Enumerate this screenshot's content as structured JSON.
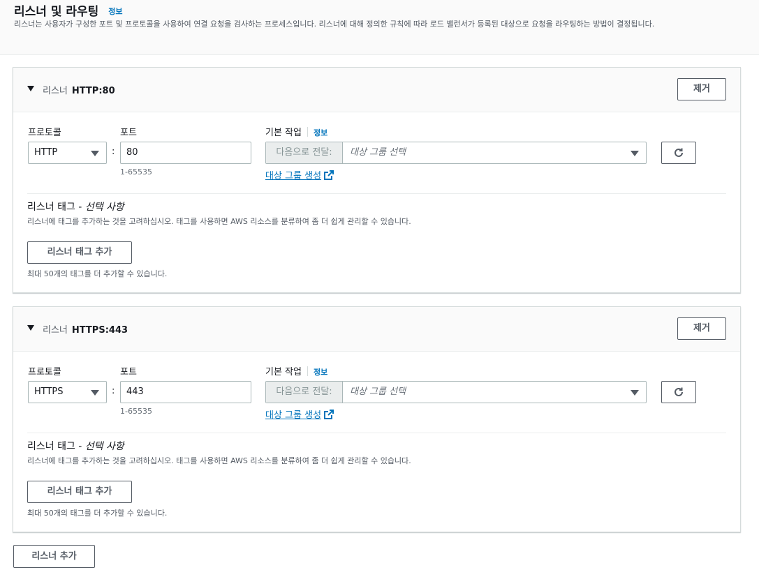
{
  "section": {
    "title": "리스너 및 라우팅",
    "info": "정보",
    "description": "리스너는 사용자가 구성한 포트 및 프로토콜을 사용하여 연결 요청을 검사하는 프로세스입니다. 리스너에 대해 정의한 규칙에 따라 로드 밸런서가 등록된 대상으로 요청을 라우팅하는 방법이 결정됩니다."
  },
  "listeners": [
    {
      "label": "리스너",
      "name": "HTTP:80",
      "remove": "제거",
      "protocol_label": "프로토콜",
      "protocol_value": "HTTP",
      "port_label": "포트",
      "port_value": "80",
      "port_hint": "1-65535",
      "default_action_label": "기본 작업",
      "default_action_info": "정보",
      "forward_prefix": "다음으로 전달:",
      "target_placeholder": "대상 그룹 선택",
      "create_target_link": "대상 그룹 생성",
      "tags_title": "리스너 태그 - ",
      "tags_title_optional": "선택 사항",
      "tags_desc": "리스너에 태그를 추가하는 것을 고려하십시오. 태그를 사용하면 AWS 리소스를 분류하여 좀 더 쉽게 관리할 수 있습니다.",
      "add_tag_button": "리스너 태그 추가",
      "tags_limit": "최대 50개의 태그를 더 추가할 수 있습니다."
    },
    {
      "label": "리스너",
      "name": "HTTPS:443",
      "remove": "제거",
      "protocol_label": "프로토콜",
      "protocol_value": "HTTPS",
      "port_label": "포트",
      "port_value": "443",
      "port_hint": "1-65535",
      "default_action_label": "기본 작업",
      "default_action_info": "정보",
      "forward_prefix": "다음으로 전달:",
      "target_placeholder": "대상 그룹 선택",
      "create_target_link": "대상 그룹 생성",
      "tags_title": "리스너 태그 - ",
      "tags_title_optional": "선택 사항",
      "tags_desc": "리스너에 태그를 추가하는 것을 고려하십시오. 태그를 사용하면 AWS 리소스를 분류하여 좀 더 쉽게 관리할 수 있습니다.",
      "add_tag_button": "리스너 태그 추가",
      "tags_limit": "최대 50개의 태그를 더 추가할 수 있습니다."
    }
  ],
  "add_listener_button": "리스너 추가",
  "colors": {
    "link": "#0073bb",
    "text": "#16191f",
    "muted": "#545b64",
    "border": "#aab7b8"
  },
  "icons": {
    "collapse": "caret-down-icon",
    "dropdown": "chevron-down-icon",
    "refresh": "refresh-icon",
    "external": "external-link-icon"
  }
}
